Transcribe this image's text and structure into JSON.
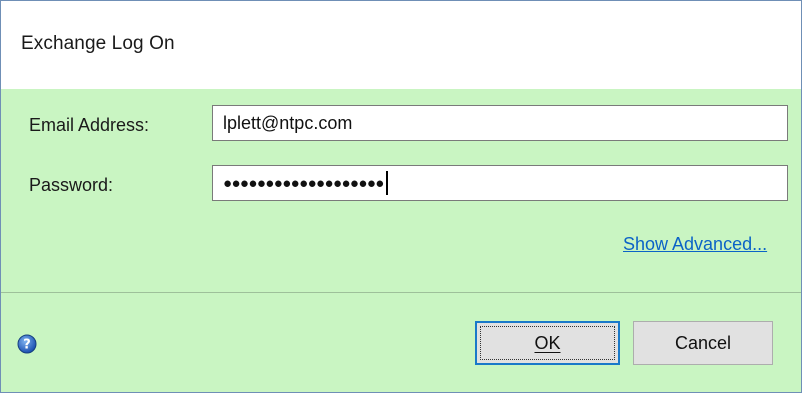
{
  "dialog": {
    "title": "Exchange Log On"
  },
  "form": {
    "email_label": "Email Address:",
    "email_value": "lplett@ntpc.com",
    "password_label": "Password:",
    "password_masked": "●●●●●●●●●●●●●●●●●●●",
    "show_advanced_label": "Show Advanced..."
  },
  "footer": {
    "help_icon": "help-icon",
    "ok_label": "OK",
    "cancel_label": "Cancel"
  },
  "colors": {
    "body_background": "#c9f5c2",
    "link": "#0b63c7",
    "default_button_border": "#1979c9"
  }
}
